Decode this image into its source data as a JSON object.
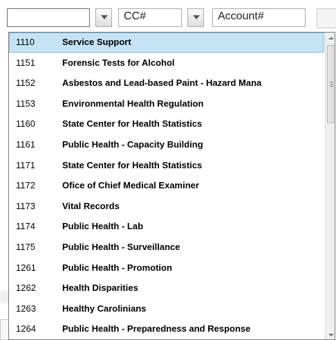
{
  "toolbar": {
    "select_value": "",
    "cc_value": "CC#",
    "account_value": "Account#"
  },
  "dropdown": {
    "selected_index": 0,
    "items": [
      {
        "code": "1110",
        "name": "Service Support"
      },
      {
        "code": "1151",
        "name": "Forensic Tests for Alcohol"
      },
      {
        "code": "1152",
        "name": "Asbestos and Lead-based Paint - Hazard Mana"
      },
      {
        "code": "1153",
        "name": "Environmental Health Regulation"
      },
      {
        "code": "1160",
        "name": "State Center for Health Statistics"
      },
      {
        "code": "1161",
        "name": "Public Health - Capacity Building"
      },
      {
        "code": "1171",
        "name": "State Center for Health Statistics"
      },
      {
        "code": "1172",
        "name": "Ofice of Chief Medical Examiner"
      },
      {
        "code": "1173",
        "name": "Vital Records"
      },
      {
        "code": "1174",
        "name": "Public Health - Lab"
      },
      {
        "code": "1175",
        "name": "Public Health - Surveillance"
      },
      {
        "code": "1261",
        "name": "Public Health - Promotion"
      },
      {
        "code": "1262",
        "name": "Health Disparities"
      },
      {
        "code": "1263",
        "name": "Healthy Carolinians"
      },
      {
        "code": "1264",
        "name": "Public Health - Preparedness and Response"
      }
    ]
  },
  "colors": {
    "selected_bg": "#c5e3f5",
    "selected_border": "#89bfe0"
  },
  "icons": [
    "chevron-down-icon",
    "scroll-up-arrow-icon",
    "scroll-down-arrow-icon",
    "scroll-grip-icon"
  ]
}
